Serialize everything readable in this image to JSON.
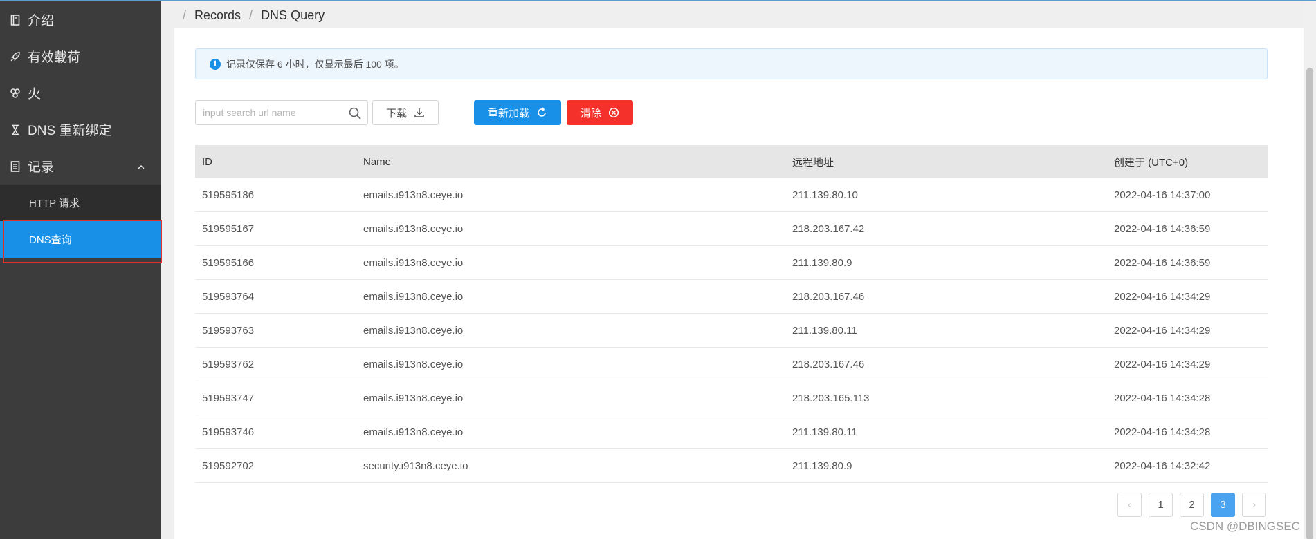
{
  "sidebar": {
    "items": [
      {
        "label": "介绍",
        "icon": "book-icon"
      },
      {
        "label": "有效载荷",
        "icon": "rocket-icon"
      },
      {
        "label": "火",
        "icon": "fan-icon"
      },
      {
        "label": "DNS 重新绑定",
        "icon": "hourglass-icon"
      },
      {
        "label": "记录",
        "icon": "list-icon"
      }
    ],
    "submenu": [
      {
        "label": "HTTP 请求"
      },
      {
        "label": "DNS查询"
      }
    ]
  },
  "breadcrumb": {
    "sep": "/",
    "items": [
      "Records",
      "DNS Query"
    ]
  },
  "alert": {
    "icon": "i",
    "text": "记录仅保存 6 小时，仅显示最后 100 项。"
  },
  "toolbar": {
    "search_placeholder": "input search url name",
    "download_label": "下载",
    "reload_label": "重新加载",
    "clear_label": "清除"
  },
  "table": {
    "headers": [
      "ID",
      "Name",
      "远程地址",
      "创建于 (UTC+0)"
    ],
    "rows": [
      [
        "519595186",
        "emails.i913n8.ceye.io",
        "211.139.80.10",
        "2022-04-16 14:37:00"
      ],
      [
        "519595167",
        "emails.i913n8.ceye.io",
        "218.203.167.42",
        "2022-04-16 14:36:59"
      ],
      [
        "519595166",
        "emails.i913n8.ceye.io",
        "211.139.80.9",
        "2022-04-16 14:36:59"
      ],
      [
        "519593764",
        "emails.i913n8.ceye.io",
        "218.203.167.46",
        "2022-04-16 14:34:29"
      ],
      [
        "519593763",
        "emails.i913n8.ceye.io",
        "211.139.80.11",
        "2022-04-16 14:34:29"
      ],
      [
        "519593762",
        "emails.i913n8.ceye.io",
        "218.203.167.46",
        "2022-04-16 14:34:29"
      ],
      [
        "519593747",
        "emails.i913n8.ceye.io",
        "218.203.165.113",
        "2022-04-16 14:34:28"
      ],
      [
        "519593746",
        "emails.i913n8.ceye.io",
        "211.139.80.11",
        "2022-04-16 14:34:28"
      ],
      [
        "519592702",
        "security.i913n8.ceye.io",
        "211.139.80.9",
        "2022-04-16 14:32:42"
      ]
    ]
  },
  "pagination": {
    "prev": "‹",
    "pages": [
      "1",
      "2",
      "3"
    ],
    "current": "3",
    "next": "›"
  },
  "watermark": "CSDN @DBINGSEC",
  "colors": {
    "primary": "#1890e8",
    "danger": "#f5312c",
    "sidebar": "#3c3c3c",
    "highlight_box": "#e0302d"
  }
}
